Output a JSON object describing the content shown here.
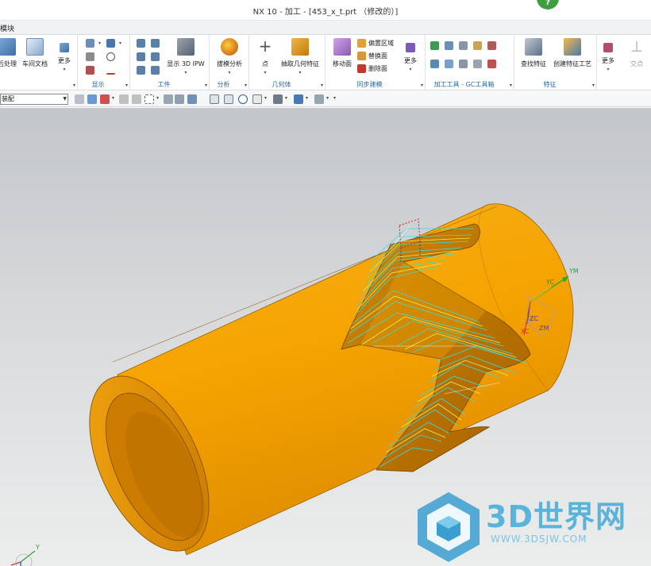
{
  "window": {
    "title": "NX 10 - 加工 - [453_x_t.prt （修改的）]"
  },
  "ribbon_tabs": [
    {
      "label": "模块"
    }
  ],
  "ribbon": {
    "groups": [
      {
        "label": "",
        "buttons": [
          {
            "label": "后处理",
            "icon": "postprocess-icon"
          },
          {
            "label": "车间文档",
            "icon": "shop-doc-icon"
          },
          {
            "label": "更多",
            "icon": "more-icon"
          }
        ]
      },
      {
        "label": "显示",
        "buttons": [],
        "icons": [
          "display-toolpath-icon",
          "display-path-icon",
          "display-layers-icon",
          "display-target-icon",
          "display-curve-icon",
          "display-more-icon"
        ]
      },
      {
        "label": "工件",
        "buttons": [
          {
            "label": "显示 3D IPW",
            "icon": "show-3d-ipw-icon"
          }
        ],
        "icons": [
          "flag-icon-1",
          "flag-icon-2",
          "flag-icon-3",
          "flag-icon-4",
          "flag-icon-5",
          "flag-icon-6"
        ]
      },
      {
        "label": "分析",
        "buttons": [
          {
            "label": "拔模分析",
            "icon": "draft-analysis-icon"
          }
        ]
      },
      {
        "label": "几何体",
        "buttons": [
          {
            "label": "点",
            "icon": "point-icon"
          },
          {
            "label": "抽取几何特征",
            "icon": "extract-geometry-icon"
          }
        ]
      },
      {
        "label": "同步建模",
        "buttons": [
          {
            "label": "移动面",
            "icon": "move-face-icon"
          },
          {
            "label": "更多",
            "icon": "sync-more-icon"
          }
        ],
        "small_buttons": [
          {
            "label": "偏置区域",
            "icon": "offset-region-icon"
          },
          {
            "label": "替换面",
            "icon": "replace-face-icon"
          },
          {
            "label": "删除面",
            "icon": "delete-face-icon"
          }
        ]
      },
      {
        "label": "加工工具 - GC工具箱",
        "buttons": [],
        "icons": [
          "gc-tool-icon-1",
          "gc-tool-icon-2",
          "gc-tool-icon-3",
          "gc-tool-icon-4",
          "gc-tool-icon-5",
          "gc-tool-icon-6",
          "gc-tool-icon-7",
          "gc-tool-icon-8",
          "gc-tool-icon-9",
          "gc-tool-icon-10"
        ]
      },
      {
        "label": "特征",
        "buttons": [
          {
            "label": "查找特征",
            "icon": "find-feature-icon"
          },
          {
            "label": "创建特征工艺",
            "icon": "create-feature-process-icon"
          }
        ]
      },
      {
        "label": "",
        "buttons": [
          {
            "label": "更多",
            "icon": "more-icon-2"
          },
          {
            "label": "交点",
            "icon": "intersection-icon"
          }
        ]
      }
    ]
  },
  "selection_bar": {
    "filter_value": "装配"
  },
  "viewport": {
    "csys_labels": {
      "ym": "YM",
      "yc": "YC",
      "zc": "ZC",
      "xc": "XC",
      "zm": "ZM",
      "triad_y": "Y"
    }
  },
  "watermark": {
    "title": "3D世界网",
    "url": "WWW.3DSJW.COM"
  },
  "colors": {
    "part": "#f5a300",
    "part_dark": "#c87b00",
    "toolpath_cyan": "#33e0e0",
    "toolpath_yellow": "#e8f050",
    "group_label": "#2a6aa8",
    "accent_green": "#3f9e3f"
  }
}
